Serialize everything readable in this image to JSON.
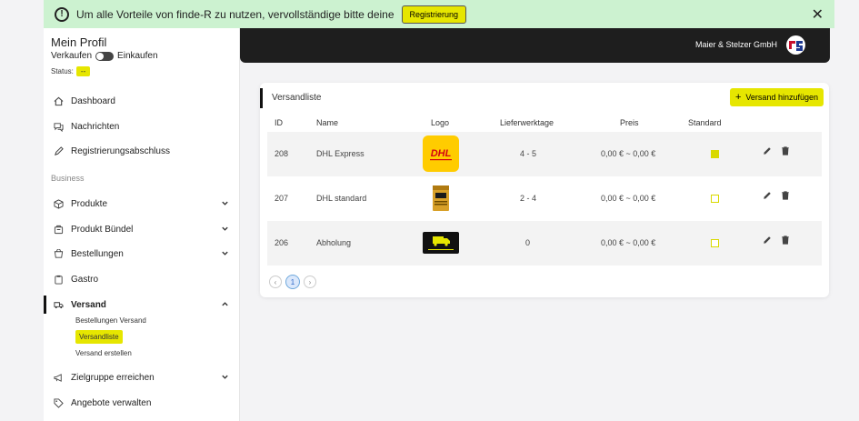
{
  "banner": {
    "message": "Um alle Vorteile von finde-R zu nutzen, vervollständige bitte deine",
    "register_label": "Registrierung",
    "close_glyph": "✕"
  },
  "sidebar": {
    "profile_title": "Mein Profil",
    "toggle_left": "Verkaufen",
    "toggle_right": "Einkaufen",
    "status_label": "Status:",
    "status_value": "--",
    "items": [
      {
        "label": "Dashboard",
        "icon": "home-icon"
      },
      {
        "label": "Nachrichten",
        "icon": "chat-icon"
      },
      {
        "label": "Registrierungsabschluss",
        "icon": "pen-icon"
      }
    ],
    "section_label": "Business",
    "business_items": [
      {
        "label": "Produkte",
        "icon": "box-icon"
      },
      {
        "label": "Produkt Bündel",
        "icon": "bundle-icon"
      },
      {
        "label": "Bestellungen",
        "icon": "cart-icon"
      },
      {
        "label": "Gastro",
        "icon": "clipboard-icon"
      },
      {
        "label": "Versand",
        "icon": "truck-icon"
      }
    ],
    "versand_sub": [
      "Bestellungen Versand",
      "Versandliste",
      "Versand erstellen"
    ],
    "bottom_items": [
      {
        "label": "Zielgruppe erreichen",
        "icon": "megaphone-icon"
      },
      {
        "label": "Angebote verwalten",
        "icon": "tag-icon"
      }
    ]
  },
  "topbar": {
    "company": "Maier & Stelzer GmbH"
  },
  "card": {
    "title": "Versandliste",
    "add_label": "Versand hinzufügen",
    "columns": [
      "ID",
      "Name",
      "Logo",
      "Lieferwerktage",
      "Preis",
      "Standard"
    ],
    "rows": [
      {
        "id": "208",
        "name": "DHL Express",
        "days": "4 - 5",
        "price": "0,00 € ~ 0,00 €",
        "standard": true,
        "logo": "dhl-logo"
      },
      {
        "id": "207",
        "name": "DHL standard",
        "days": "2 - 4",
        "price": "0,00 € ~ 0,00 €",
        "standard": false,
        "logo": "package-logo"
      },
      {
        "id": "206",
        "name": "Abholung",
        "days": "0",
        "price": "0,00 € ~ 0,00 €",
        "standard": false,
        "logo": "truck-logo"
      }
    ],
    "pagination": {
      "prev": "‹",
      "current": "1",
      "next": "›"
    }
  },
  "colors": {
    "accent": "#e6e600",
    "banner_bg": "#ccf2d0",
    "topbar_bg": "#1e1e1e",
    "dhl_yellow": "#ffcc00",
    "dhl_red": "#d40511"
  }
}
